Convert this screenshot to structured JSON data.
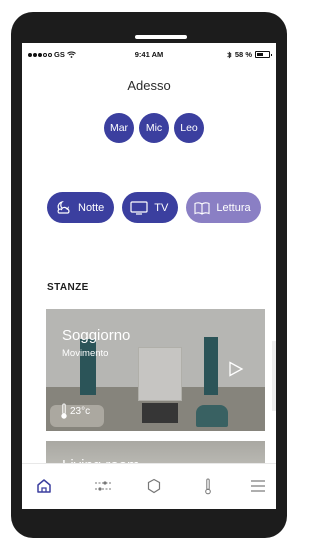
{
  "status_bar": {
    "carrier": "GS",
    "time": "9:41 AM",
    "battery": "58 %",
    "icons": [
      "signal-dots-icon",
      "wifi-icon",
      "bluetooth-icon",
      "battery-icon"
    ]
  },
  "header": {
    "title": "Adesso"
  },
  "people": [
    {
      "label": "Mar"
    },
    {
      "label": "Mic"
    },
    {
      "label": "Leo"
    }
  ],
  "scenes": [
    {
      "label": "Notte",
      "icon": "moon-cloud-icon"
    },
    {
      "label": "TV",
      "icon": "tv-icon"
    },
    {
      "label": "Lettura",
      "icon": "book-icon"
    }
  ],
  "rooms_section": {
    "title": "STANZE"
  },
  "rooms": [
    {
      "name": "Soggiorno",
      "status": "Movimento",
      "temperature": "23°c"
    },
    {
      "name": "Living room"
    }
  ],
  "tab_bar": {
    "items": [
      "home-icon",
      "sliders-icon",
      "shield-icon",
      "thermometer-icon",
      "menu-icon"
    ]
  },
  "colors": {
    "primary": "#3b3f9f",
    "primary_light": "#8a7fc4",
    "device": "#1c1c1c"
  }
}
